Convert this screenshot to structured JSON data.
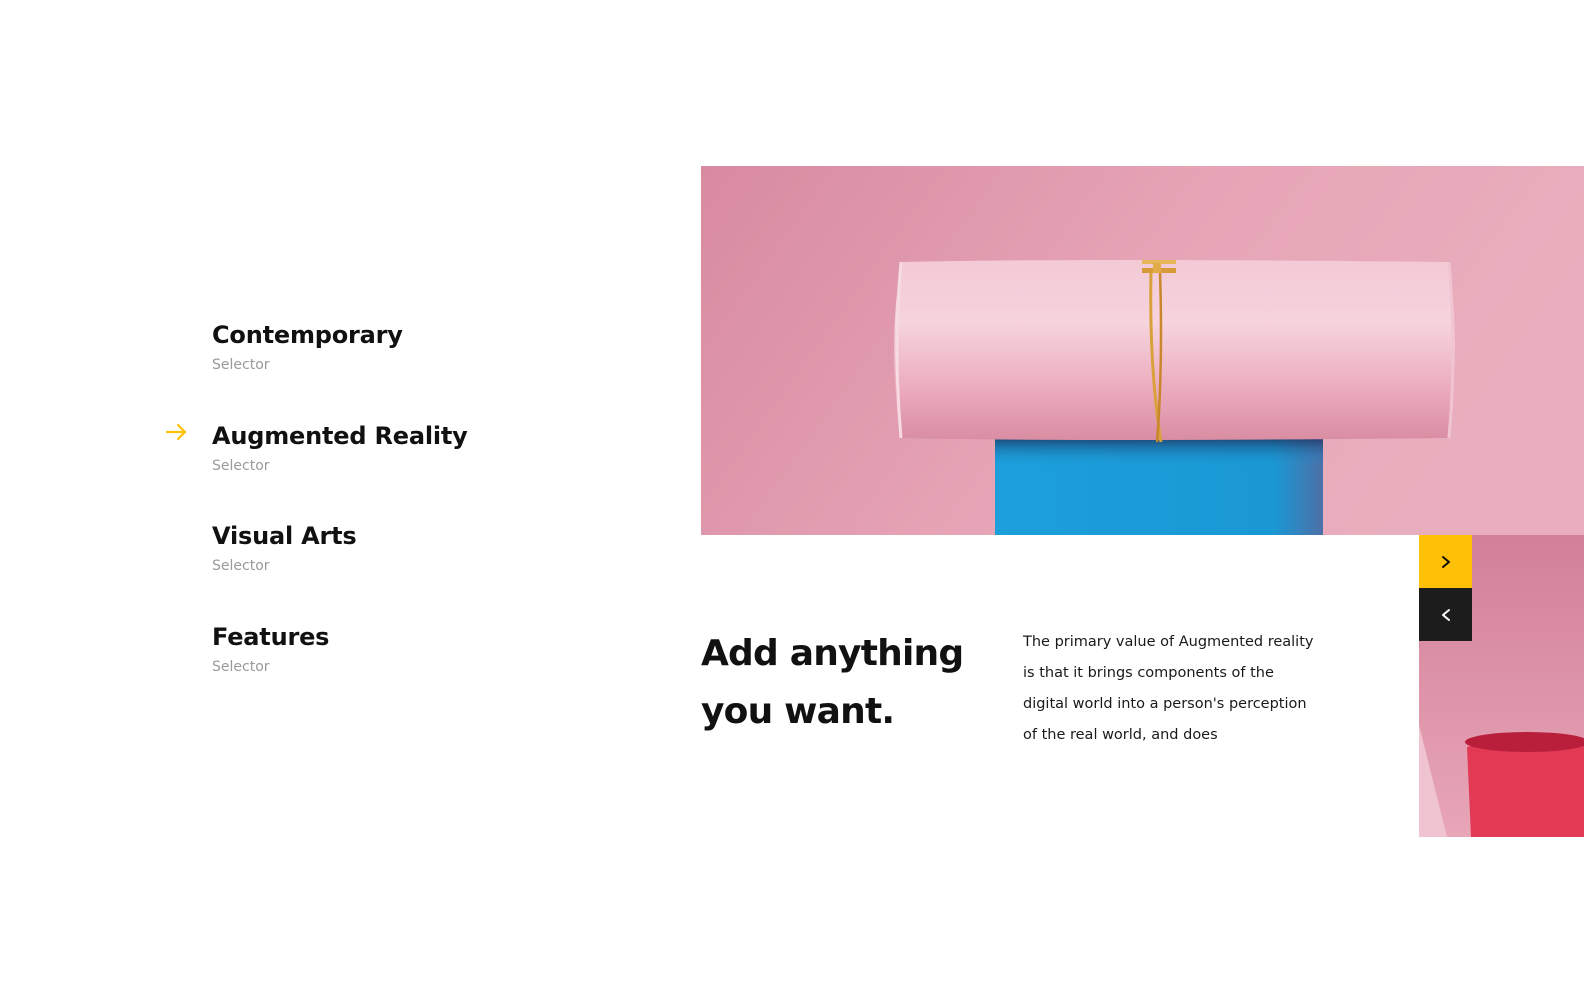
{
  "menu": {
    "items": [
      {
        "title": "Contemporary",
        "subtitle": "Selector",
        "active": false
      },
      {
        "title": "Augmented Reality",
        "subtitle": "Selector",
        "active": true
      },
      {
        "title": "Visual Arts",
        "subtitle": "Selector",
        "active": false
      },
      {
        "title": "Features",
        "subtitle": "Selector",
        "active": false
      }
    ],
    "active_indicator_icon": "arrow-right-icon"
  },
  "slide": {
    "title": "Add anything you want.",
    "description": "The primary value of Augmented reality is that it brings components of the digital world into a person's perception of the real world, and does",
    "image": "pink-tube-with-gold-bracelet-on-blue-block"
  },
  "navigation": {
    "next_icon": "chevron-right-icon",
    "prev_icon": "chevron-left-icon"
  },
  "colors": {
    "accent": "#ffc107",
    "dark": "#1c1c1c",
    "muted_text": "#9a9a9a",
    "image_background": "#dc94a8",
    "tube_pink": "#f3c0ce",
    "block_blue": "#1a9ad6",
    "bracelet_gold": "#d9a13c",
    "cup_red": "#e23a55"
  }
}
